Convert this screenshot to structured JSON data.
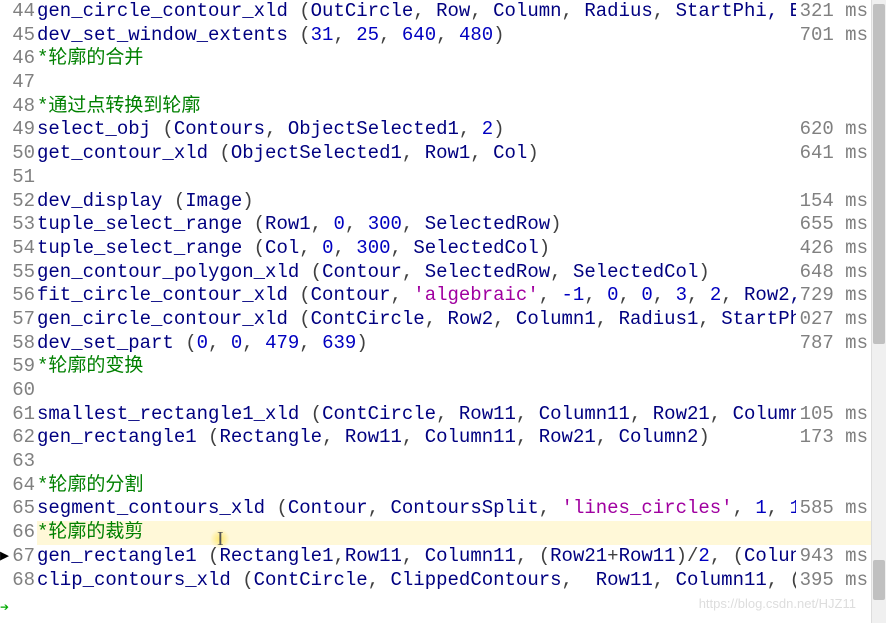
{
  "editor": {
    "first_line_number": 44,
    "cursor_line": 66,
    "program_counter_line": 68,
    "lines": [
      {
        "num": 44,
        "timing": "321 ms",
        "tokens": [
          {
            "t": "gen_circle_contour_xld",
            "c": "kw-op"
          },
          {
            "t": " (",
            "c": "paren"
          },
          {
            "t": "OutCircle",
            "c": "id"
          },
          {
            "t": ", ",
            "c": "paren"
          },
          {
            "t": "Row",
            "c": "id"
          },
          {
            "t": ", ",
            "c": "paren"
          },
          {
            "t": "Column",
            "c": "id"
          },
          {
            "t": ", ",
            "c": "paren"
          },
          {
            "t": "Radius",
            "c": "id"
          },
          {
            "t": ", ",
            "c": "paren"
          },
          {
            "t": "StartPhi",
            "c": "id"
          },
          {
            "t": ", E",
            "c": "id"
          }
        ]
      },
      {
        "num": 45,
        "timing": "701 ms",
        "tokens": [
          {
            "t": "dev_set_window_extents",
            "c": "kw-op"
          },
          {
            "t": " (",
            "c": "paren"
          },
          {
            "t": "31",
            "c": "num"
          },
          {
            "t": ", ",
            "c": "paren"
          },
          {
            "t": "25",
            "c": "num"
          },
          {
            "t": ", ",
            "c": "paren"
          },
          {
            "t": "640",
            "c": "num"
          },
          {
            "t": ", ",
            "c": "paren"
          },
          {
            "t": "480",
            "c": "num"
          },
          {
            "t": ")",
            "c": "paren"
          }
        ]
      },
      {
        "num": 46,
        "timing": "",
        "tokens": [
          {
            "t": "*轮廓的合并",
            "c": "cmt"
          }
        ]
      },
      {
        "num": 47,
        "timing": "",
        "tokens": []
      },
      {
        "num": 48,
        "timing": "",
        "tokens": [
          {
            "t": "*通过点转换到轮廓",
            "c": "cmt"
          }
        ]
      },
      {
        "num": 49,
        "timing": "620 ms",
        "tokens": [
          {
            "t": "select_obj",
            "c": "kw-op"
          },
          {
            "t": " (",
            "c": "paren"
          },
          {
            "t": "Contours",
            "c": "id"
          },
          {
            "t": ", ",
            "c": "paren"
          },
          {
            "t": "ObjectSelected1",
            "c": "id"
          },
          {
            "t": ", ",
            "c": "paren"
          },
          {
            "t": "2",
            "c": "num"
          },
          {
            "t": ")",
            "c": "paren"
          }
        ]
      },
      {
        "num": 50,
        "timing": "641 ms",
        "tokens": [
          {
            "t": "get_contour_xld",
            "c": "kw-op"
          },
          {
            "t": " (",
            "c": "paren"
          },
          {
            "t": "ObjectSelected1",
            "c": "id"
          },
          {
            "t": ", ",
            "c": "paren"
          },
          {
            "t": "Row1",
            "c": "id"
          },
          {
            "t": ", ",
            "c": "paren"
          },
          {
            "t": "Col",
            "c": "id"
          },
          {
            "t": ")",
            "c": "paren"
          }
        ]
      },
      {
        "num": 51,
        "timing": "",
        "tokens": []
      },
      {
        "num": 52,
        "timing": "154 ms",
        "tokens": [
          {
            "t": "dev_display",
            "c": "kw-op"
          },
          {
            "t": " (",
            "c": "paren"
          },
          {
            "t": "Image",
            "c": "id"
          },
          {
            "t": ")",
            "c": "paren"
          }
        ]
      },
      {
        "num": 53,
        "timing": "655 ms",
        "tokens": [
          {
            "t": "tuple_select_range",
            "c": "kw-op"
          },
          {
            "t": " (",
            "c": "paren"
          },
          {
            "t": "Row1",
            "c": "id"
          },
          {
            "t": ", ",
            "c": "paren"
          },
          {
            "t": "0",
            "c": "num"
          },
          {
            "t": ", ",
            "c": "paren"
          },
          {
            "t": "300",
            "c": "num"
          },
          {
            "t": ", ",
            "c": "paren"
          },
          {
            "t": "SelectedRow",
            "c": "id"
          },
          {
            "t": ")",
            "c": "paren"
          }
        ]
      },
      {
        "num": 54,
        "timing": "426 ms",
        "tokens": [
          {
            "t": "tuple_select_range",
            "c": "kw-op"
          },
          {
            "t": " (",
            "c": "paren"
          },
          {
            "t": "Col",
            "c": "id"
          },
          {
            "t": ", ",
            "c": "paren"
          },
          {
            "t": "0",
            "c": "num"
          },
          {
            "t": ", ",
            "c": "paren"
          },
          {
            "t": "300",
            "c": "num"
          },
          {
            "t": ", ",
            "c": "paren"
          },
          {
            "t": "SelectedCol",
            "c": "id"
          },
          {
            "t": ")",
            "c": "paren"
          }
        ]
      },
      {
        "num": 55,
        "timing": "648 ms",
        "tokens": [
          {
            "t": "gen_contour_polygon_xld",
            "c": "kw-op"
          },
          {
            "t": " (",
            "c": "paren"
          },
          {
            "t": "Contour",
            "c": "id"
          },
          {
            "t": ", ",
            "c": "paren"
          },
          {
            "t": "SelectedRow",
            "c": "id"
          },
          {
            "t": ", ",
            "c": "paren"
          },
          {
            "t": "SelectedCol",
            "c": "id"
          },
          {
            "t": ")",
            "c": "paren"
          }
        ]
      },
      {
        "num": 56,
        "timing": "729 ms",
        "tokens": [
          {
            "t": "fit_circle_contour_xld",
            "c": "kw-op"
          },
          {
            "t": " (",
            "c": "paren"
          },
          {
            "t": "Contour",
            "c": "id"
          },
          {
            "t": ", ",
            "c": "paren"
          },
          {
            "t": "'algebraic'",
            "c": "str"
          },
          {
            "t": ", ",
            "c": "paren"
          },
          {
            "t": "-1",
            "c": "num"
          },
          {
            "t": ", ",
            "c": "paren"
          },
          {
            "t": "0",
            "c": "num"
          },
          {
            "t": ", ",
            "c": "paren"
          },
          {
            "t": "0",
            "c": "num"
          },
          {
            "t": ", ",
            "c": "paren"
          },
          {
            "t": "3",
            "c": "num"
          },
          {
            "t": ", ",
            "c": "paren"
          },
          {
            "t": "2",
            "c": "num"
          },
          {
            "t": ", ",
            "c": "paren"
          },
          {
            "t": "Row2,",
            "c": "id"
          }
        ]
      },
      {
        "num": 57,
        "timing": "027 ms",
        "tokens": [
          {
            "t": "gen_circle_contour_xld",
            "c": "kw-op"
          },
          {
            "t": " (",
            "c": "paren"
          },
          {
            "t": "ContCircle",
            "c": "id"
          },
          {
            "t": ", ",
            "c": "paren"
          },
          {
            "t": "Row2",
            "c": "id"
          },
          {
            "t": ", ",
            "c": "paren"
          },
          {
            "t": "Column1",
            "c": "id"
          },
          {
            "t": ", ",
            "c": "paren"
          },
          {
            "t": "Radius1",
            "c": "id"
          },
          {
            "t": ", ",
            "c": "paren"
          },
          {
            "t": "StartPh",
            "c": "id"
          }
        ]
      },
      {
        "num": 58,
        "timing": "787 ms",
        "tokens": [
          {
            "t": "dev_set_part",
            "c": "kw-op"
          },
          {
            "t": " (",
            "c": "paren"
          },
          {
            "t": "0",
            "c": "num"
          },
          {
            "t": ", ",
            "c": "paren"
          },
          {
            "t": "0",
            "c": "num"
          },
          {
            "t": ", ",
            "c": "paren"
          },
          {
            "t": "479",
            "c": "num"
          },
          {
            "t": ", ",
            "c": "paren"
          },
          {
            "t": "639",
            "c": "num"
          },
          {
            "t": ")",
            "c": "paren"
          }
        ]
      },
      {
        "num": 59,
        "timing": "",
        "tokens": [
          {
            "t": "*轮廓的变换",
            "c": "cmt"
          }
        ]
      },
      {
        "num": 60,
        "timing": "",
        "tokens": []
      },
      {
        "num": 61,
        "timing": "105 ms",
        "tokens": [
          {
            "t": "smallest_rectangle1_xld",
            "c": "kw-op"
          },
          {
            "t": " (",
            "c": "paren"
          },
          {
            "t": "ContCircle",
            "c": "id"
          },
          {
            "t": ", ",
            "c": "paren"
          },
          {
            "t": "Row11",
            "c": "id"
          },
          {
            "t": ", ",
            "c": "paren"
          },
          {
            "t": "Column11",
            "c": "id"
          },
          {
            "t": ", ",
            "c": "paren"
          },
          {
            "t": "Row21",
            "c": "id"
          },
          {
            "t": ", ",
            "c": "paren"
          },
          {
            "t": "Column",
            "c": "id"
          }
        ]
      },
      {
        "num": 62,
        "timing": "173 ms",
        "tokens": [
          {
            "t": "gen_rectangle1",
            "c": "kw-op"
          },
          {
            "t": " (",
            "c": "paren"
          },
          {
            "t": "Rectangle",
            "c": "id"
          },
          {
            "t": ", ",
            "c": "paren"
          },
          {
            "t": "Row11",
            "c": "id"
          },
          {
            "t": ", ",
            "c": "paren"
          },
          {
            "t": "Column11",
            "c": "id"
          },
          {
            "t": ", ",
            "c": "paren"
          },
          {
            "t": "Row21",
            "c": "id"
          },
          {
            "t": ", ",
            "c": "paren"
          },
          {
            "t": "Column2",
            "c": "id"
          },
          {
            "t": ")",
            "c": "paren"
          }
        ]
      },
      {
        "num": 63,
        "timing": "",
        "tokens": []
      },
      {
        "num": 64,
        "timing": "",
        "tokens": [
          {
            "t": "*轮廓的分割",
            "c": "cmt"
          }
        ]
      },
      {
        "num": 65,
        "timing": "585 ms",
        "tokens": [
          {
            "t": "segment_contours_xld",
            "c": "kw-op"
          },
          {
            "t": " (",
            "c": "paren"
          },
          {
            "t": "Contour",
            "c": "id"
          },
          {
            "t": ", ",
            "c": "paren"
          },
          {
            "t": "ContoursSplit",
            "c": "id"
          },
          {
            "t": ", ",
            "c": "paren"
          },
          {
            "t": "'lines_circles'",
            "c": "str"
          },
          {
            "t": ", ",
            "c": "paren"
          },
          {
            "t": "1",
            "c": "num"
          },
          {
            "t": ", ",
            "c": "paren"
          },
          {
            "t": "1",
            "c": "num"
          }
        ]
      },
      {
        "num": 66,
        "timing": "",
        "hl": true,
        "tokens": [
          {
            "t": "*轮廓的裁剪",
            "c": "cmt"
          }
        ]
      },
      {
        "num": 67,
        "timing": "943 ms",
        "tokens": [
          {
            "t": "gen_rectangle1",
            "c": "kw-op"
          },
          {
            "t": " (",
            "c": "paren"
          },
          {
            "t": "Rectangle1",
            "c": "id"
          },
          {
            "t": ",",
            "c": "paren"
          },
          {
            "t": "Row11",
            "c": "id"
          },
          {
            "t": ", ",
            "c": "paren"
          },
          {
            "t": "Column11",
            "c": "id"
          },
          {
            "t": ", (",
            "c": "paren"
          },
          {
            "t": "Row21",
            "c": "id"
          },
          {
            "t": "+",
            "c": "paren"
          },
          {
            "t": "Row11",
            "c": "id"
          },
          {
            "t": ")/",
            "c": "paren"
          },
          {
            "t": "2",
            "c": "num"
          },
          {
            "t": ", (",
            "c": "paren"
          },
          {
            "t": "Colun",
            "c": "id"
          }
        ]
      },
      {
        "num": 68,
        "timing": "395 ms",
        "tokens": [
          {
            "t": "clip_contours_xld",
            "c": "kw-op"
          },
          {
            "t": " (",
            "c": "paren"
          },
          {
            "t": "ContCircle",
            "c": "id"
          },
          {
            "t": ", ",
            "c": "paren"
          },
          {
            "t": "ClippedContours",
            "c": "id"
          },
          {
            "t": ",  ",
            "c": "paren"
          },
          {
            "t": "Row11",
            "c": "id"
          },
          {
            "t": ", ",
            "c": "paren"
          },
          {
            "t": "Column11",
            "c": "id"
          },
          {
            "t": ", (",
            "c": "paren"
          }
        ]
      }
    ]
  },
  "watermark": "https://blog.csdn.net/HJZ11"
}
